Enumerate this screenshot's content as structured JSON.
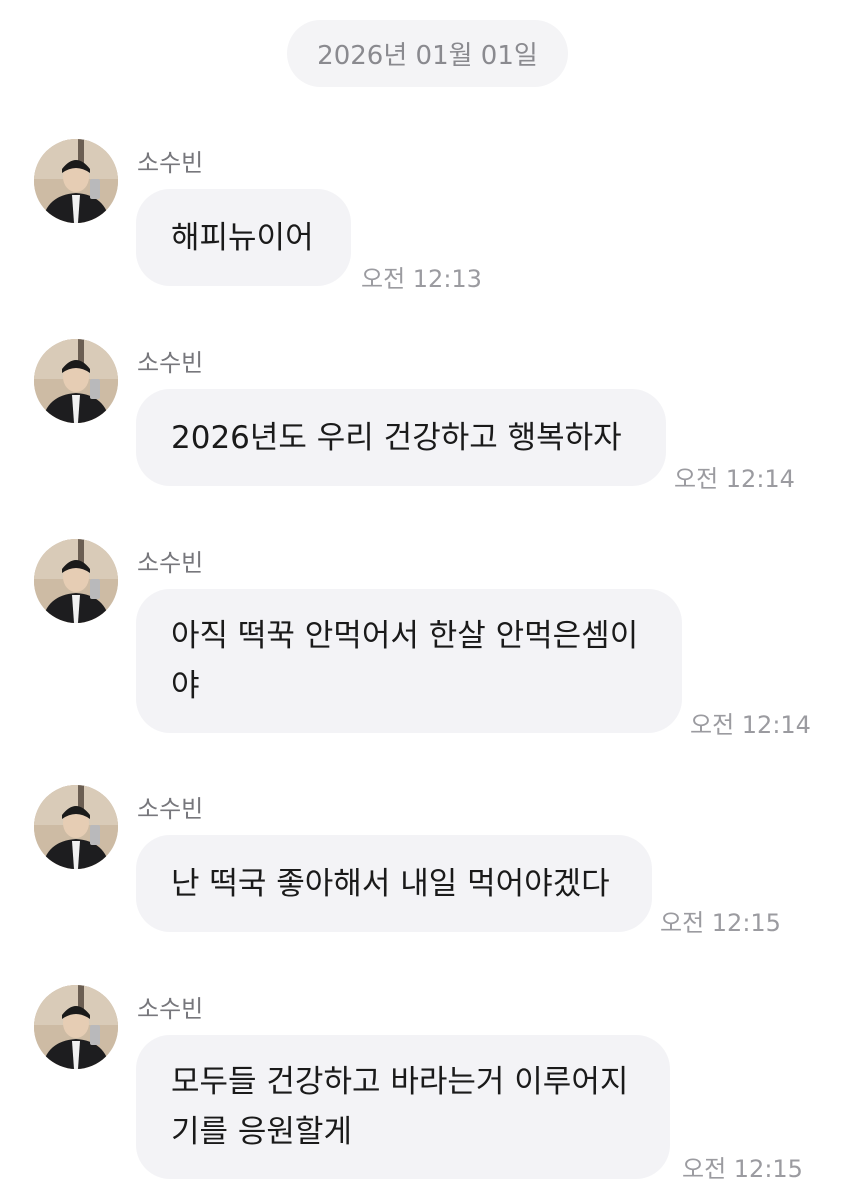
{
  "date_divider": "2026년 01월 01일",
  "messages": [
    {
      "sender": "소수빈",
      "lines": [
        "해피뉴이어"
      ],
      "time": "오전 12:13"
    },
    {
      "sender": "소수빈",
      "lines": [
        "2026년도 우리 건강하고 행복하자"
      ],
      "time": "오전 12:14"
    },
    {
      "sender": "소수빈",
      "lines": [
        "아직 떡꾹 안먹어서 한살 안먹은셈이",
        "야"
      ],
      "time": "오전 12:14"
    },
    {
      "sender": "소수빈",
      "lines": [
        "난 떡국 좋아해서 내일 먹어야겠다"
      ],
      "time": "오전 12:15"
    },
    {
      "sender": "소수빈",
      "lines": [
        "모두들 건강하고 바라는거 이루어지",
        "기를 응원할게"
      ],
      "time": "오전 12:15"
    }
  ],
  "colors": {
    "bubble": "#f3f3f6",
    "date_pill": "#f4f4f6",
    "sender_text": "#77777c",
    "time_text": "#9b9ba0"
  },
  "icons": {
    "avatar": "profile-photo-avatar"
  }
}
